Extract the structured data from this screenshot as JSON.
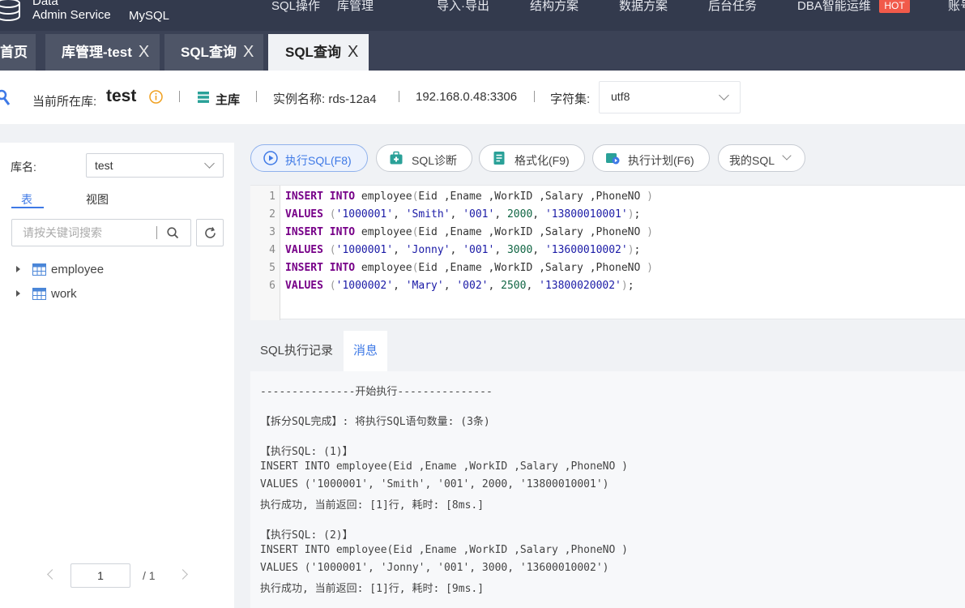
{
  "header": {
    "brand_line1": "Data",
    "brand_line2": "Admin Service",
    "db_type": "MySQL",
    "nav": [
      "SQL操作",
      "库管理",
      "导入·导出",
      "结构方案",
      "数据方案",
      "后台任务",
      "DBA智能运维",
      "账号"
    ],
    "hot_badge": "HOT"
  },
  "tabs": [
    {
      "label": "首页",
      "close": ""
    },
    {
      "label": "库管理-test",
      "close": "X"
    },
    {
      "label": "SQL查询",
      "close": "X"
    },
    {
      "label": "SQL查询",
      "close": "X",
      "active": true
    }
  ],
  "info": {
    "current_db_label": "当前所在库:",
    "current_db": "test",
    "role": "主库",
    "instance": "实例名称: rds-12a4",
    "address": "192.168.0.48:3306",
    "charset_label": "字符集:",
    "charset": "utf8"
  },
  "sidebar": {
    "db_label": "库名:",
    "db_value": "test",
    "tab_table": "表",
    "tab_view": "视图",
    "search_placeholder": "请按关键词搜索",
    "tables": [
      "employee",
      "work"
    ],
    "page_current": "1",
    "page_total": "/ 1"
  },
  "toolbar": {
    "execute": "执行SQL(F8)",
    "diagnose": "SQL诊断",
    "format": "格式化(F9)",
    "plan": "执行计划(F6)",
    "my_sql": "我的SQL"
  },
  "editor": {
    "lines": [
      "INSERT INTO employee(Eid ,Ename ,WorkID ,Salary ,PhoneNO )",
      "VALUES ('1000001', 'Smith', '001', 2000, '13800010001');",
      "INSERT INTO employee(Eid ,Ename ,WorkID ,Salary ,PhoneNO )",
      "VALUES ('1000001', 'Jonny', '001', 3000, '13600010002');",
      "INSERT INTO employee(Eid ,Ename ,WorkID ,Salary ,PhoneNO )",
      "VALUES ('1000002', 'Mary', '002', 2500, '13800020002');"
    ]
  },
  "results": {
    "tab_history": "SQL执行记录",
    "tab_messages": "消息",
    "messages": [
      "---------------开始执行---------------",
      "【拆分SQL完成】: 将执行SQL语句数量: (3条)",
      "【执行SQL: (1)】",
      "INSERT INTO employee(Eid ,Ename ,WorkID ,Salary ,PhoneNO )",
      "VALUES ('1000001', 'Smith', '001', 2000, '13800010001')",
      "执行成功, 当前返回: [1]行, 耗时: [8ms.]",
      "【执行SQL: (2)】",
      "INSERT INTO employee(Eid ,Ename ,WorkID ,Salary ,PhoneNO )",
      "VALUES ('1000001', 'Jonny', '001', 3000, '13600010002')",
      "执行成功, 当前返回: [1]行, 耗时: [9ms.]"
    ]
  },
  "colors": {
    "nav_bg": "#333a4d",
    "tab_bg": "#3b4256",
    "accent": "#3e79e6",
    "hot": "#f15a4a",
    "info_icon": "#f0a020",
    "primary_db": "#2aa198"
  },
  "icons": {
    "logo": "database-stack-icon",
    "info": "info-circle-icon",
    "role": "server-stack-icon",
    "search": "search-icon",
    "refresh": "refresh-icon",
    "table": "table-grid-icon",
    "execute": "play-circle-icon",
    "diagnose": "medkit-icon",
    "format": "document-lines-icon",
    "plan": "plan-play-icon"
  }
}
